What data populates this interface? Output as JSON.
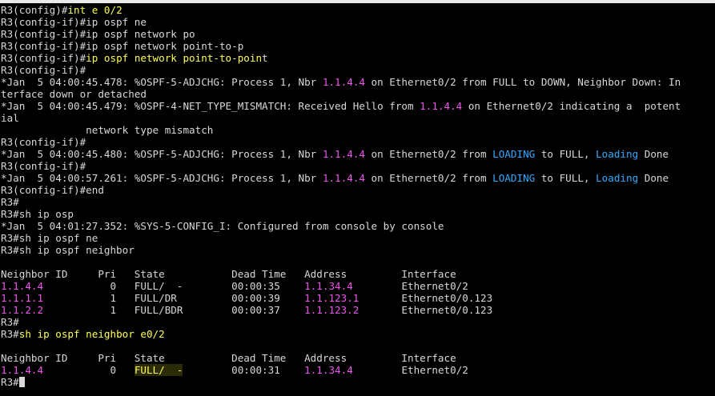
{
  "colors": {
    "background": "#000000",
    "text": "#d8d8d8",
    "command_yellow": "#ffff55",
    "address_magenta": "#ee55ee",
    "state_cyan": "#33aaff"
  },
  "terminal": {
    "lines": [
      [
        {
          "t": "R3(config)#",
          "c": "t"
        },
        {
          "t": "int e 0/2",
          "c": "y"
        }
      ],
      [
        {
          "t": "R3(config-if)#ip ospf ne",
          "c": "t"
        }
      ],
      [
        {
          "t": "R3(config-if)#ip ospf network po",
          "c": "t"
        }
      ],
      [
        {
          "t": "R3(config-if)#ip ospf network point-to-p",
          "c": "t"
        }
      ],
      [
        {
          "t": "R3(config-if)#",
          "c": "t"
        },
        {
          "t": "ip ospf network point-to-poin",
          "c": "y"
        },
        {
          "t": "t",
          "c": "t"
        }
      ],
      [
        {
          "t": "R3(config-if)#",
          "c": "t"
        }
      ],
      [
        {
          "t": "*Jan  5 04:00:45.478: %OSPF-5-ADJCHG: Process 1, Nbr ",
          "c": "t"
        },
        {
          "t": "1.1.4.4",
          "c": "m"
        },
        {
          "t": " on Ethernet0/2 from FULL to DOWN, Neighbor Down: In",
          "c": "t"
        }
      ],
      [
        {
          "t": "terface down or detached",
          "c": "t"
        }
      ],
      [
        {
          "t": "*Jan  5 04:00:45.479: %OSPF-4-NET_TYPE_MISMATCH: Received Hello from ",
          "c": "t"
        },
        {
          "t": "1.1.4.4",
          "c": "m"
        },
        {
          "t": " on Ethernet0/2 indicating a  potent",
          "c": "t"
        }
      ],
      [
        {
          "t": "ial",
          "c": "t"
        }
      ],
      [
        {
          "t": "              network type mismatch",
          "c": "t"
        }
      ],
      [
        {
          "t": "R3(config-if)#",
          "c": "t"
        }
      ],
      [
        {
          "t": "*Jan  5 04:00:45.480: %OSPF-5-ADJCHG: Process 1, Nbr ",
          "c": "t"
        },
        {
          "t": "1.1.4.4",
          "c": "m"
        },
        {
          "t": " on Ethernet0/2 from ",
          "c": "t"
        },
        {
          "t": "LOADING",
          "c": "c"
        },
        {
          "t": " to FULL, ",
          "c": "t"
        },
        {
          "t": "Loading",
          "c": "c"
        },
        {
          "t": " Done",
          "c": "t"
        }
      ],
      [
        {
          "t": "R3(config-if)#",
          "c": "t"
        }
      ],
      [
        {
          "t": "*Jan  5 04:00:57.261: %OSPF-5-ADJCHG: Process 1, Nbr ",
          "c": "t"
        },
        {
          "t": "1.1.4.4",
          "c": "m"
        },
        {
          "t": " on Ethernet0/2 from ",
          "c": "t"
        },
        {
          "t": "LOADING",
          "c": "c"
        },
        {
          "t": " to FULL, ",
          "c": "t"
        },
        {
          "t": "Loading",
          "c": "c"
        },
        {
          "t": " Done",
          "c": "t"
        }
      ],
      [
        {
          "t": "R3(config-if)#end",
          "c": "t"
        }
      ],
      [
        {
          "t": "R3#",
          "c": "t"
        }
      ],
      [
        {
          "t": "R3#sh ip osp",
          "c": "t"
        }
      ],
      [
        {
          "t": "*Jan  5 04:01:27.352: %SYS-5-CONFIG_I: Configured from console by console",
          "c": "t"
        }
      ],
      [
        {
          "t": "R3#sh ip ospf ne",
          "c": "t"
        }
      ],
      [
        {
          "t": "R3#sh ip ospf neighbor",
          "c": "t"
        }
      ],
      [
        {
          "t": "",
          "c": "t"
        }
      ],
      [
        {
          "t": "Neighbor ID     Pri   State           Dead Time   Address         Interface",
          "c": "t"
        }
      ],
      [
        {
          "t": "1.1.4.4",
          "c": "m"
        },
        {
          "t": "           0   FULL/  -        00:00:35    ",
          "c": "t"
        },
        {
          "t": "1.1.34.4",
          "c": "m"
        },
        {
          "t": "        Ethernet0/2",
          "c": "t"
        }
      ],
      [
        {
          "t": "1.1.1.1",
          "c": "m"
        },
        {
          "t": "           1   FULL/DR         00:00:39    ",
          "c": "t"
        },
        {
          "t": "1.1.123.1",
          "c": "m"
        },
        {
          "t": "       Ethernet0/0.123",
          "c": "t"
        }
      ],
      [
        {
          "t": "1.1.2.2",
          "c": "m"
        },
        {
          "t": "           1   FULL/BDR        00:00:37    ",
          "c": "t"
        },
        {
          "t": "1.1.123.2",
          "c": "m"
        },
        {
          "t": "       Ethernet0/0.123",
          "c": "t"
        }
      ],
      [
        {
          "t": "R3#",
          "c": "t"
        }
      ],
      [
        {
          "t": "R3#",
          "c": "t"
        },
        {
          "t": "sh ip ospf neighbor e0/2",
          "c": "y"
        }
      ],
      [
        {
          "t": "",
          "c": "t"
        }
      ],
      [
        {
          "t": "Neighbor ID     Pri   State           Dead Time   Address         Interface",
          "c": "t"
        }
      ],
      [
        {
          "t": "1.1.4.4",
          "c": "m"
        },
        {
          "t": "           0   ",
          "c": "t"
        },
        {
          "t": "FULL/  -",
          "c": "y hl"
        },
        {
          "t": "        00:00:31    ",
          "c": "t"
        },
        {
          "t": "1.1.34.4",
          "c": "m"
        },
        {
          "t": "        Ethernet0/2",
          "c": "t"
        }
      ],
      [
        {
          "t": "R3#",
          "c": "t"
        }
      ]
    ]
  }
}
